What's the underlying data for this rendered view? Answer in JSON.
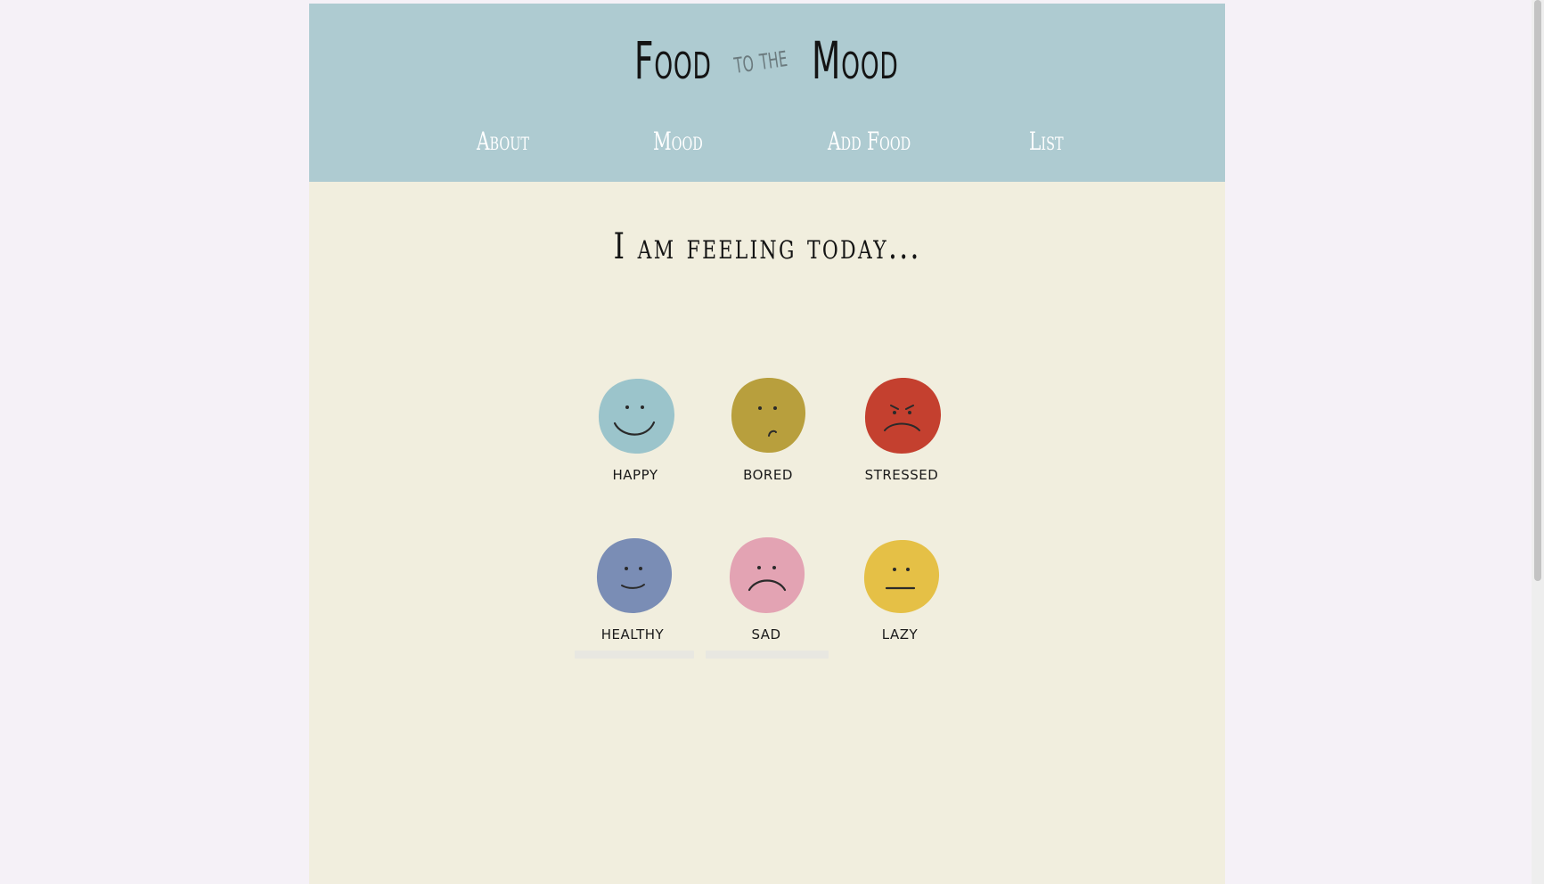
{
  "header": {
    "logo_word1": "Food",
    "logo_small": "to the",
    "logo_word2": "Mood"
  },
  "nav": {
    "about": "About",
    "mood": "Mood",
    "add_food": "Add Food",
    "list": "List"
  },
  "main": {
    "title": "I am feeling today..."
  },
  "moods": [
    {
      "label": "happy",
      "color": "#9bc4cb",
      "icon": "happy-face-icon"
    },
    {
      "label": "bored",
      "color": "#b89f3d",
      "icon": "bored-face-icon"
    },
    {
      "label": "stressed",
      "color": "#c4402f",
      "icon": "stressed-face-icon"
    },
    {
      "label": "healthy",
      "color": "#7a8db5",
      "icon": "healthy-face-icon"
    },
    {
      "label": "sad",
      "color": "#e3a3b3",
      "icon": "sad-face-icon"
    },
    {
      "label": "lazy",
      "color": "#e5c046",
      "icon": "lazy-face-icon"
    }
  ],
  "colors": {
    "page_background": "#f5f1f7",
    "content_background": "#f1eede",
    "header_background": "#aecbd1",
    "nav_text": "#ffffff"
  }
}
